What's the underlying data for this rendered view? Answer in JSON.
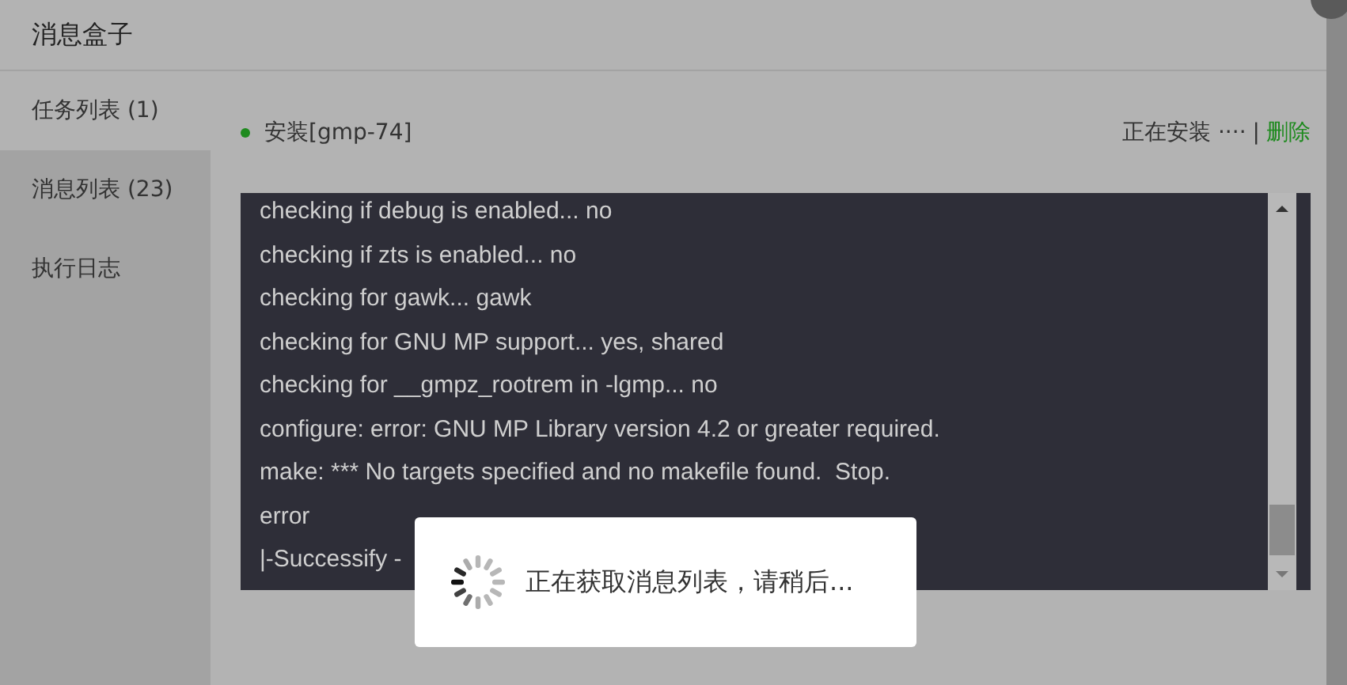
{
  "window": {
    "title": "消息盒子"
  },
  "sidebar": {
    "items": [
      {
        "label": "任务列表 (1)",
        "selected": true
      },
      {
        "label": "消息列表 (23)",
        "selected": false
      },
      {
        "label": "执行日志",
        "selected": false
      }
    ]
  },
  "task": {
    "name": "安装[gmp-74]",
    "status": "正在安装 ····",
    "separator": "|",
    "action": "删除",
    "color": "#1e8a1e"
  },
  "log": {
    "lines": [
      "checking if debug is enabled... no",
      "checking if zts is enabled... no",
      "checking for gawk... gawk",
      "checking for GNU MP support... yes, shared",
      "checking for __gmpz_rootrem in -lgmp... no",
      "configure: error: GNU MP Library version 4.2 or greater required.",
      "make: *** No targets specified and no makefile found.  Stop.",
      "error",
      "|-Successify -"
    ]
  },
  "loading": {
    "message": "正在获取消息列表，请稍后..."
  }
}
